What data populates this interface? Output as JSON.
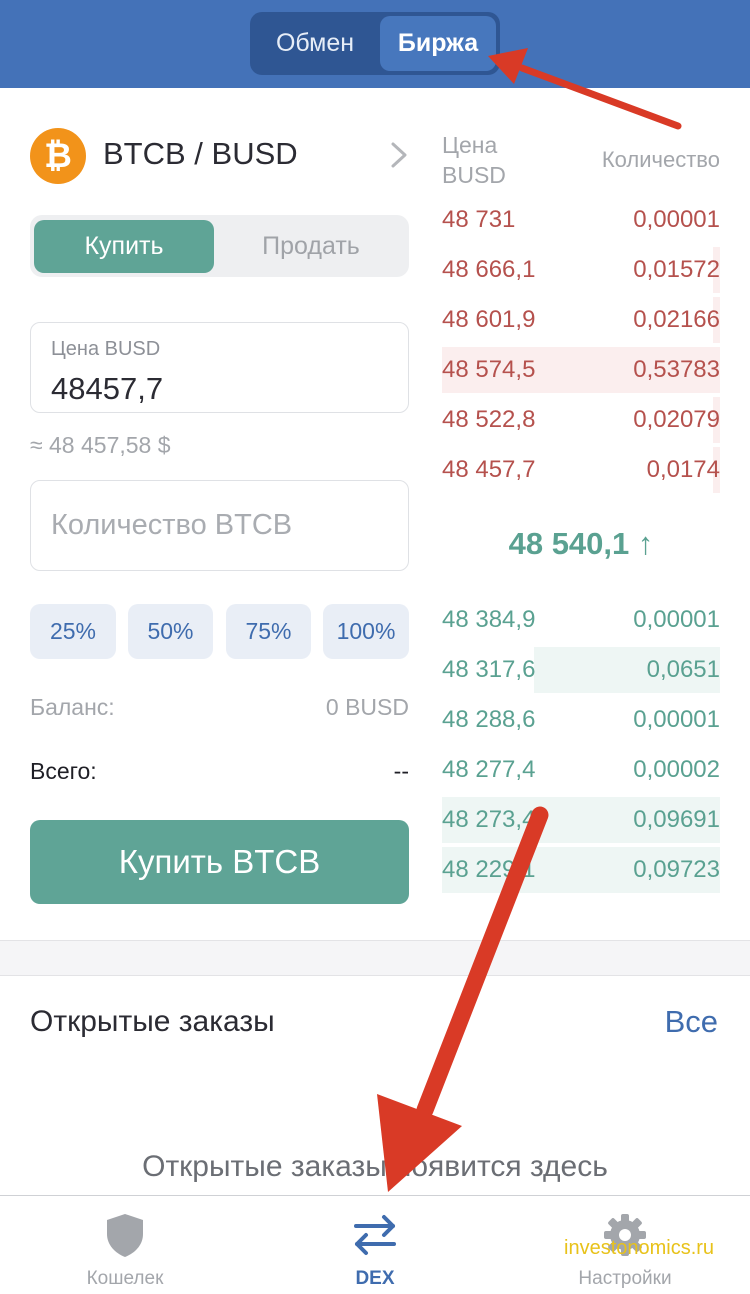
{
  "header": {
    "segments": [
      "Обмен",
      "Биржа"
    ],
    "active_segment": "Биржа",
    "bg_color": "#4472b8"
  },
  "pair": {
    "coin_icon": "bitcoin-icon",
    "coin_symbol": "₿",
    "name": "BTCB / BUSD"
  },
  "trade": {
    "buy_label": "Купить",
    "sell_label": "Продать",
    "price_label": "Цена BUSD",
    "price_value": "48457,7",
    "approx_usd": "≈ 48 457,58 $",
    "quantity_placeholder": "Количество BTCB",
    "percents": [
      "25%",
      "50%",
      "75%",
      "100%"
    ],
    "balance_label": "Баланс:",
    "balance_value": "0 BUSD",
    "total_label": "Всего:",
    "total_value": "--",
    "submit_label": "Купить BTCB",
    "accent_color": "#5fa496"
  },
  "orderbook": {
    "price_header": "Цена BUSD",
    "qty_header": "Количество",
    "asks": [
      {
        "price": "48 731",
        "qty": "0,00001",
        "depth": 0
      },
      {
        "price": "48 666,1",
        "qty": "0,01572",
        "depth": 0.03
      },
      {
        "price": "48 601,9",
        "qty": "0,02166",
        "depth": 0.03
      },
      {
        "price": "48 574,5",
        "qty": "0,53783",
        "depth": 1.0
      },
      {
        "price": "48 522,8",
        "qty": "0,02079",
        "depth": 0.03
      },
      {
        "price": "48 457,7",
        "qty": "0,0174",
        "depth": 0.03
      }
    ],
    "mid_price": "48 540,1 ↑",
    "bids": [
      {
        "price": "48 384,9",
        "qty": "0,00001",
        "depth": 0
      },
      {
        "price": "48 317,6",
        "qty": "0,0651",
        "depth": 0.67
      },
      {
        "price": "48 288,6",
        "qty": "0,00001",
        "depth": 0
      },
      {
        "price": "48 277,4",
        "qty": "0,00002",
        "depth": 0
      },
      {
        "price": "48 273,4",
        "qty": "0,09691",
        "depth": 1.0
      },
      {
        "price": "48 229,1",
        "qty": "0,09723",
        "depth": 1.0
      }
    ],
    "ask_color": "#b5514d",
    "bid_color": "#5aa191"
  },
  "orders": {
    "title": "Открытые заказы",
    "all_link": "Все",
    "empty_text": "Открытые заказы появится здесь"
  },
  "tabbar": {
    "items": [
      {
        "label": "Кошелек",
        "icon": "shield-icon"
      },
      {
        "label": "DEX",
        "icon": "swap-arrows-icon"
      },
      {
        "label": "Настройки",
        "icon": "gear-icon"
      }
    ],
    "active": "DEX"
  },
  "watermark": "investonomics.ru"
}
